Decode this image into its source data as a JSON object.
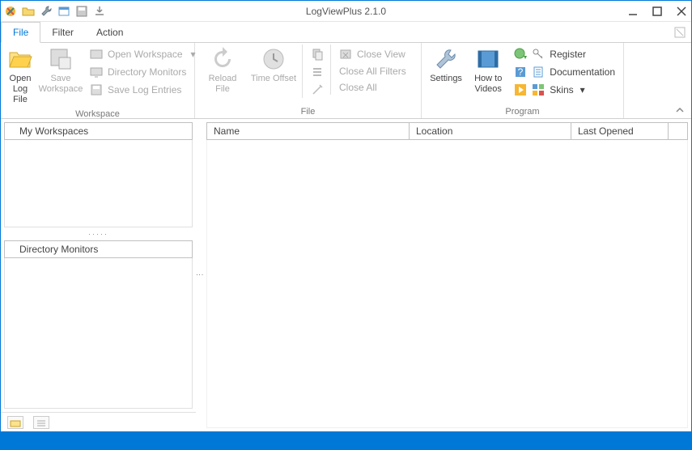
{
  "window": {
    "title": "LogViewPlus 2.1.0"
  },
  "menu": {
    "tabs": [
      "File",
      "Filter",
      "Action"
    ],
    "active": 0
  },
  "ribbon": {
    "groups": {
      "workspace": {
        "label": "Workspace",
        "open_log": "Open\nLog File",
        "save_ws": "Save\nWorkspace",
        "open_ws": "Open Workspace",
        "dir_mon": "Directory Monitors",
        "save_entries": "Save Log Entries"
      },
      "file": {
        "label": "File",
        "reload": "Reload\nFile",
        "time_offset": "Time Offset",
        "close_view": "Close View",
        "close_filters": "Close All Filters",
        "close_all": "Close All"
      },
      "program": {
        "label": "Program",
        "settings": "Settings",
        "howto": "How to\nVideos",
        "register": "Register",
        "docs": "Documentation",
        "skins": "Skins"
      }
    }
  },
  "sidebar": {
    "workspaces": "My Workspaces",
    "monitors": "Directory Monitors"
  },
  "grid": {
    "cols": {
      "name": "Name",
      "location": "Location",
      "last": "Last Opened"
    }
  }
}
